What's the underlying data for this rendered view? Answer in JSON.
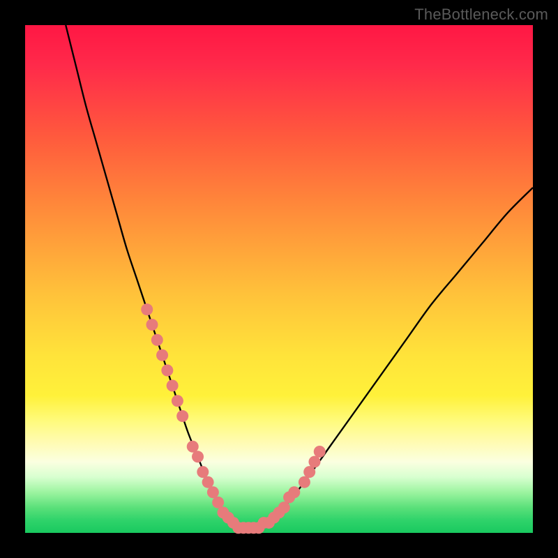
{
  "watermark": "TheBottleneck.com",
  "colors": {
    "page_bg": "#000000",
    "gradient_top": "#ff1744",
    "gradient_bottom": "#19c95f",
    "curve_stroke": "#000000",
    "dot_fill": "#e77b7b"
  },
  "chart_data": {
    "type": "line",
    "title": "",
    "xlabel": "",
    "ylabel": "",
    "xlim": [
      0,
      100
    ],
    "ylim": [
      0,
      100
    ],
    "grid": false,
    "legend": false,
    "series": [
      {
        "name": "bottleneck-curve",
        "x": [
          8,
          10,
          12,
          14,
          16,
          18,
          20,
          22,
          24,
          26,
          28,
          30,
          32,
          34,
          36,
          38,
          40,
          42,
          46,
          50,
          55,
          60,
          65,
          70,
          75,
          80,
          85,
          90,
          95,
          100
        ],
        "y": [
          100,
          92,
          84,
          77,
          70,
          63,
          56,
          50,
          44,
          38,
          32,
          26,
          20,
          15,
          10,
          6,
          3,
          1,
          1,
          4,
          10,
          17,
          24,
          31,
          38,
          45,
          51,
          57,
          63,
          68
        ]
      }
    ],
    "markers": {
      "name": "highlighted-points",
      "x": [
        24,
        25,
        26,
        27,
        28,
        29,
        30,
        31,
        33,
        34,
        35,
        36,
        37,
        38,
        39,
        40,
        41,
        42,
        43,
        44,
        45,
        46,
        47,
        48,
        49,
        50,
        51,
        52,
        53,
        55,
        56,
        57,
        58
      ],
      "y": [
        44,
        41,
        38,
        35,
        32,
        29,
        26,
        23,
        17,
        15,
        12,
        10,
        8,
        6,
        4,
        3,
        2,
        1,
        1,
        1,
        1,
        1,
        2,
        2,
        3,
        4,
        5,
        7,
        8,
        10,
        12,
        14,
        16
      ]
    }
  }
}
